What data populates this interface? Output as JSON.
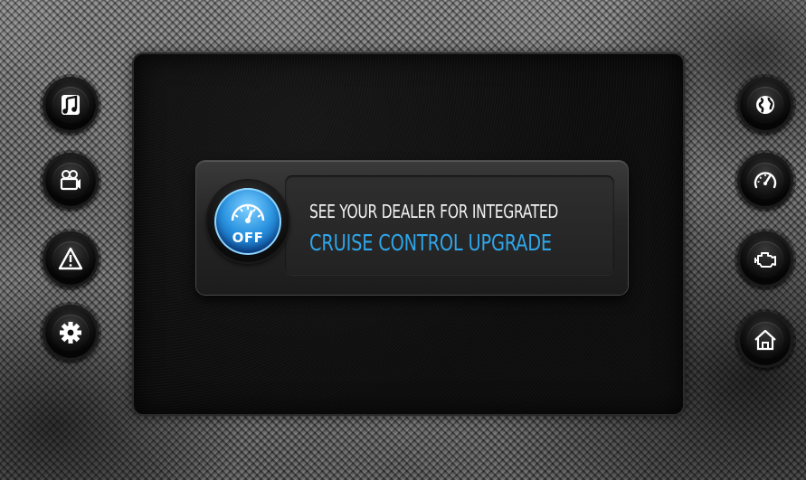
{
  "dialog": {
    "line1": "SEE YOUR DEALER FOR INTEGRATED",
    "line2": "CRUISE CONTROL UPGRADE",
    "gauge_label": "OFF",
    "accent_color": "#2fa5e8"
  },
  "left_buttons": [
    {
      "icon": "music-note-icon"
    },
    {
      "icon": "video-camera-icon"
    },
    {
      "icon": "warning-triangle-icon"
    },
    {
      "icon": "gear-icon"
    }
  ],
  "right_buttons": [
    {
      "icon": "globe-icon"
    },
    {
      "icon": "speedometer-icon"
    },
    {
      "icon": "engine-icon"
    },
    {
      "icon": "home-icon"
    }
  ]
}
